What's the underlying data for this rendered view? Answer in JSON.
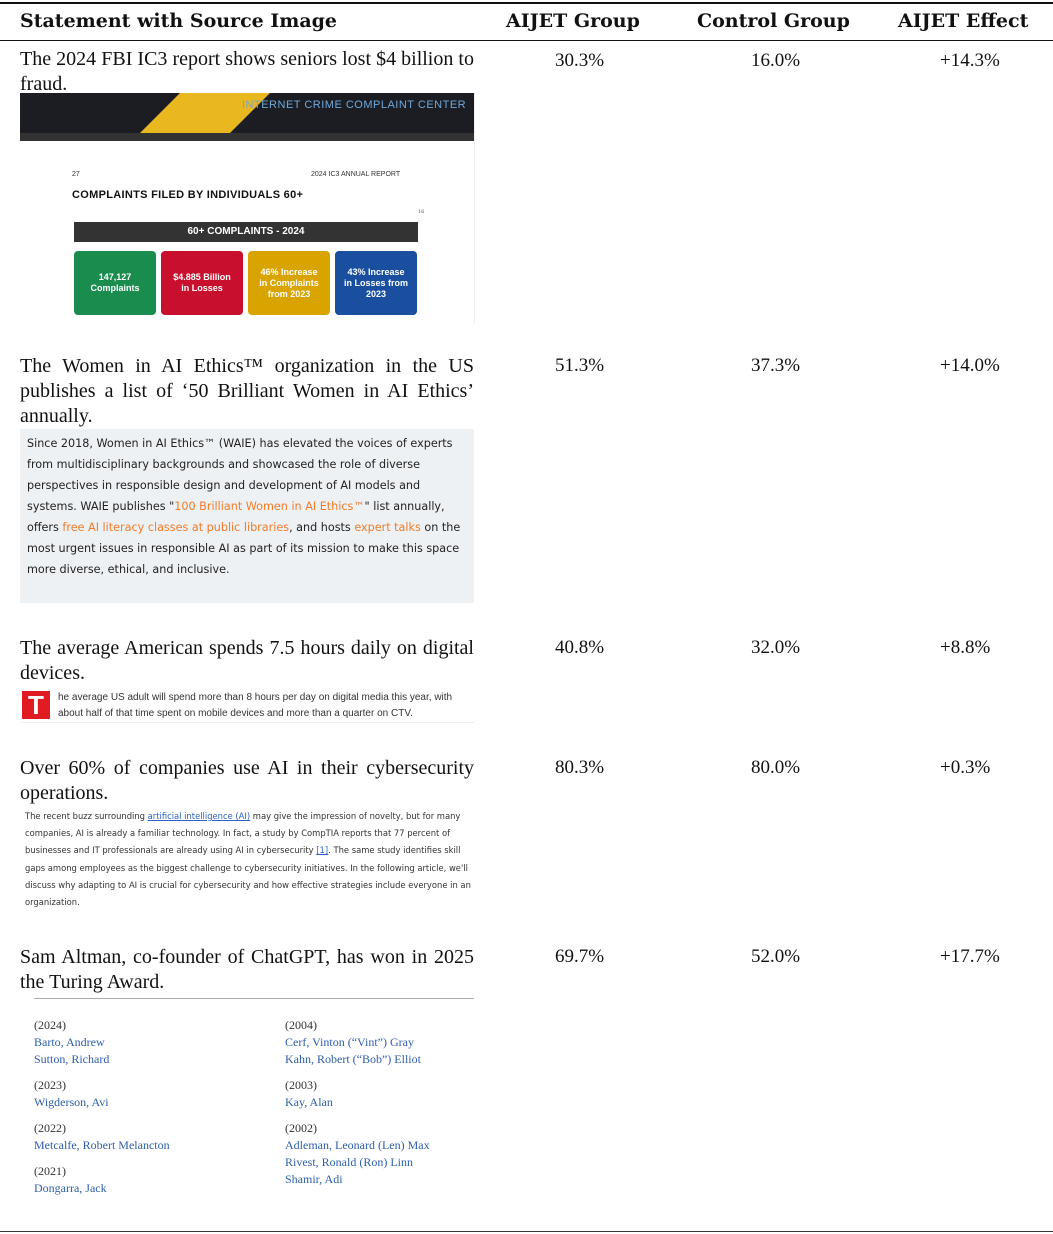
{
  "table": {
    "headers": [
      "Statement with Source Image",
      "AIJET Group",
      "Control Group",
      "AIJET Effect"
    ],
    "rows": [
      {
        "statement": "The 2024 FBI IC3 report shows seniors lost $4 billion to fraud.",
        "aijet": "30.3%",
        "control": "16.0%",
        "effect": "+14.3%",
        "source": {
          "band_title": "INTERNET CRIME COMPLAINT CENTER",
          "page_number": "27",
          "annual_report": "2024 IC3 ANNUAL REPORT",
          "title": "COMPLAINTS FILED BY INDIVIDUALS 60+",
          "mark": "16",
          "bar_label": "60+ COMPLAINTS - 2024",
          "boxes": [
            {
              "line1": "147,127",
              "line2": "Complaints",
              "line3": "",
              "color": "#1a8c4e"
            },
            {
              "line1": "$4.885 Billion",
              "line2": "in Losses",
              "line3": "",
              "color": "#c8102e"
            },
            {
              "line1": "46% Increase",
              "line2": "in Complaints",
              "line3": "from 2023",
              "color": "#d9a400"
            },
            {
              "line1": "43% Increase",
              "line2": "in Losses from",
              "line3": "2023",
              "color": "#1a4fa0"
            }
          ]
        }
      },
      {
        "statement": "The Women in AI Ethics™ organization in the US publishes a list of ‘50 Brilliant Women in AI Ethics’ annually.",
        "aijet": "51.3%",
        "control": "37.3%",
        "effect": "+14.0%",
        "source": {
          "p1": "Since 2018, Women in AI Ethics™ (WAIE) has elevated the voices of experts from multidisciplinary backgrounds and showcased the role of diverse perspectives in responsible design and development of AI models and systems. WAIE publishes \"",
          "link1": "100 Brilliant Women in AI Ethics™",
          "p2": "\" list annually, offers ",
          "link2": "free AI literacy classes at public libraries",
          "p3": ", and hosts ",
          "link3": "expert talks",
          "p4": " on the most urgent issues in responsible AI as part of its mission to make this space more diverse, ethical, and inclusive."
        }
      },
      {
        "statement": "The average American spends 7.5 hours daily on digital devices.",
        "aijet": "40.8%",
        "control": "32.0%",
        "effect": "+8.8%",
        "source": {
          "dropcap": "T",
          "text": "he average US adult will spend more than 8 hours per day on digital media this year, with about half of that time spent on mobile devices and more than a quarter on CTV."
        }
      },
      {
        "statement": "Over 60% of companies use AI in their cybersecurity operations.",
        "aijet": "80.3%",
        "control": "80.0%",
        "effect": "+0.3%",
        "source": {
          "t1": "The recent buzz surrounding ",
          "link1": "artificial intelligence (AI)",
          "t2": " may give the impression of novelty, but for many companies, AI is already a familiar technology. In fact, a study by CompTIA reports that 77 percent of businesses and IT professionals are already using AI in cybersecurity ",
          "link2": "[1]",
          "t3": ". The same study identifies skill gaps among employees as the biggest challenge to cybersecurity initiatives. In the following article, we'll discuss why adapting to AI is crucial for cybersecurity and how effective strategies include everyone in an organization."
        }
      },
      {
        "statement": "Sam Altman, co-founder of ChatGPT, has won in 2025 the Turing Award.",
        "aijet": "69.7%",
        "control": "52.0%",
        "effect": "+17.7%",
        "source": {
          "left": [
            {
              "year": "(2024)",
              "names": [
                "Barto, Andrew",
                "Sutton, Richard"
              ]
            },
            {
              "year": "(2023)",
              "names": [
                "Wigderson, Avi"
              ]
            },
            {
              "year": "(2022)",
              "names": [
                "Metcalfe, Robert Melancton"
              ]
            },
            {
              "year": "(2021)",
              "names": [
                "Dongarra, Jack"
              ]
            }
          ],
          "right": [
            {
              "year": "(2004)",
              "names": [
                "Cerf, Vinton (“Vint”) Gray",
                "Kahn, Robert (“Bob”) Elliot"
              ]
            },
            {
              "year": "(2003)",
              "names": [
                "Kay, Alan"
              ]
            },
            {
              "year": "(2002)",
              "names": [
                "Adleman, Leonard (Len) Max",
                "Rivest, Ronald (Ron) Linn",
                "Shamir, Adi"
              ]
            }
          ]
        }
      }
    ]
  }
}
